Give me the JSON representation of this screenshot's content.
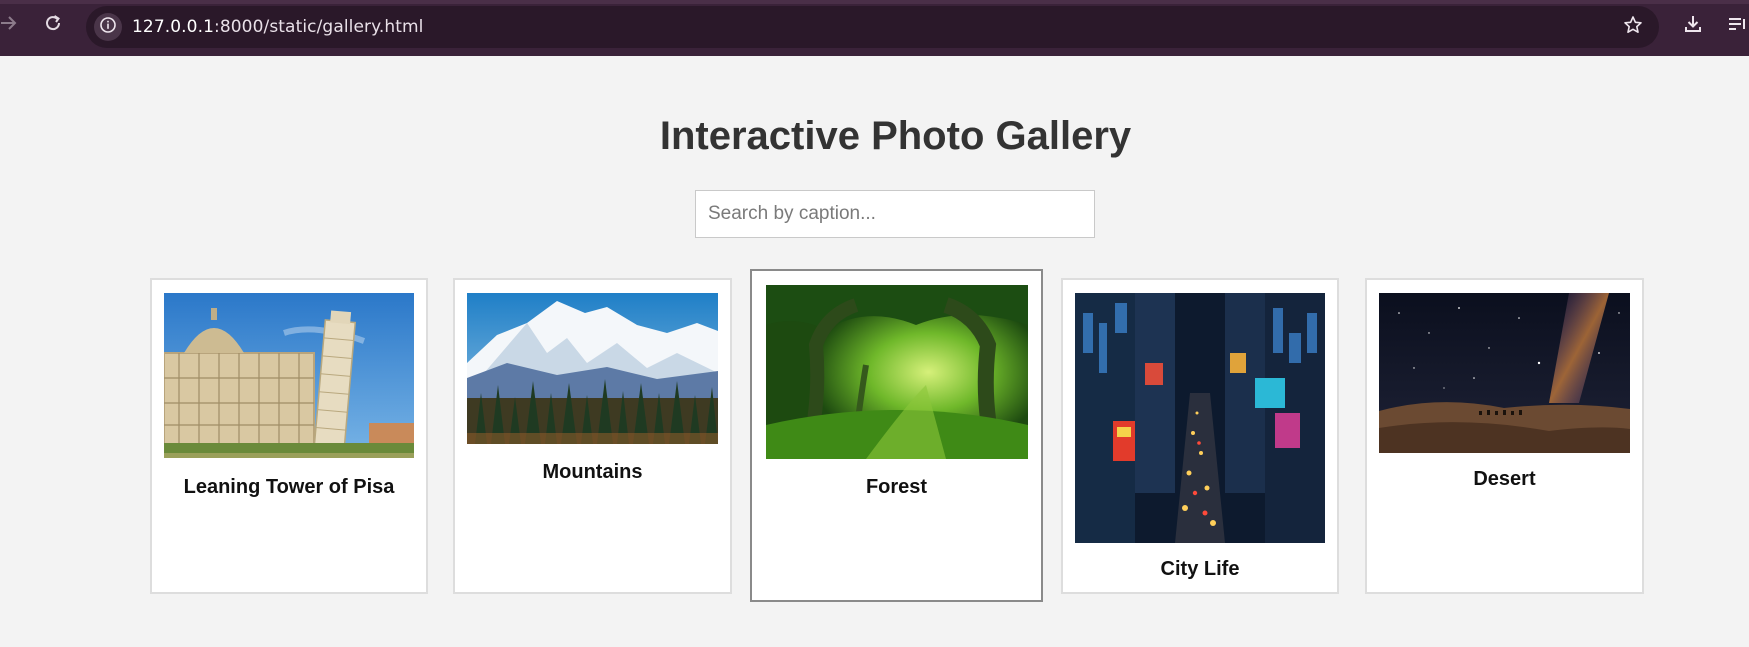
{
  "browser": {
    "url": "127.0.0.1:8000/static/gallery.html",
    "url_host": "127.0.0.1",
    "url_rest": ":8000/static/gallery.html",
    "icons": {
      "forward": "arrow-right-icon",
      "reload": "reload-icon",
      "site_info": "info-icon",
      "bookmark": "star-icon",
      "download": "download-icon",
      "queue": "list-icon"
    }
  },
  "page": {
    "title": "Interactive Photo Gallery",
    "search_placeholder": "Search by caption...",
    "search_value": ""
  },
  "gallery": {
    "items": [
      {
        "caption": "Leaning Tower of Pisa",
        "image": "pisa-photo"
      },
      {
        "caption": "Mountains",
        "image": "mountains-photo"
      },
      {
        "caption": "Forest",
        "image": "forest-photo",
        "state": "hover"
      },
      {
        "caption": "City Life",
        "image": "city-photo"
      },
      {
        "caption": "Desert",
        "image": "desert-photo"
      }
    ]
  },
  "colors": {
    "chrome": "#3a2239",
    "page_bg": "#f3f3f3",
    "title": "#333333",
    "card_border": "#dddddd",
    "card_border_hover": "#8a8a8a"
  }
}
